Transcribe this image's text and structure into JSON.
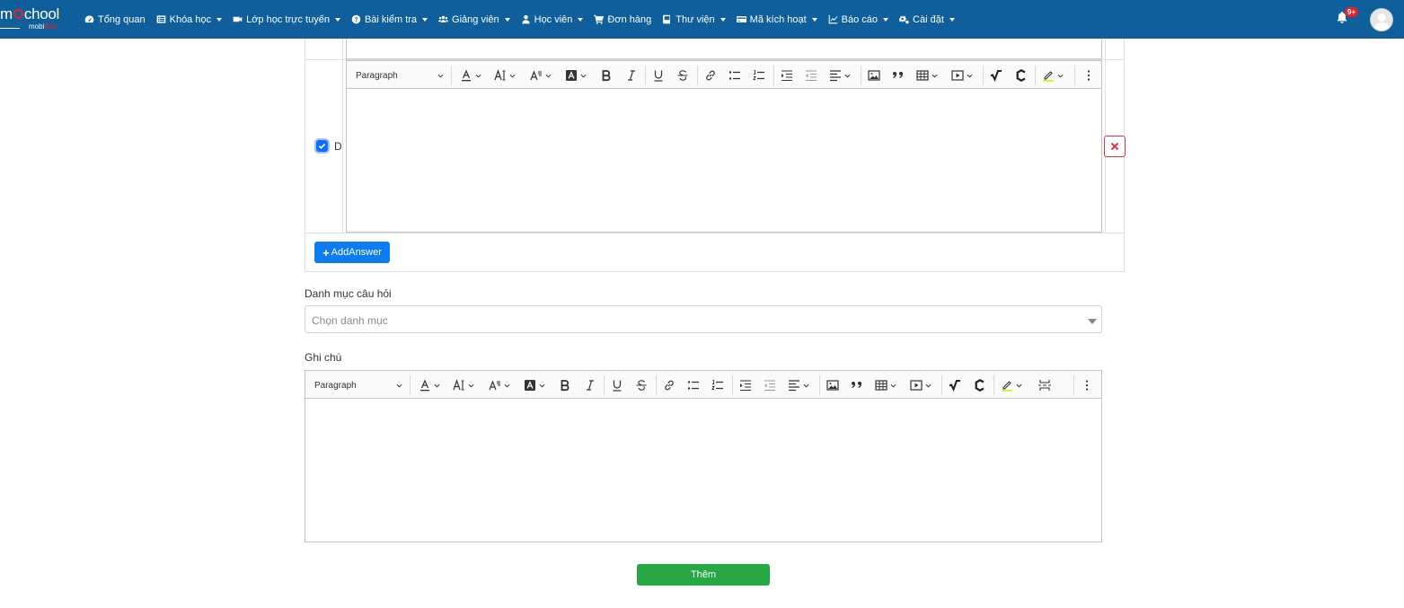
{
  "app": {
    "logo_text": "mSchool",
    "logo_sub": "mobiEdu"
  },
  "nav": {
    "items": [
      {
        "label": "Tổng quan",
        "icon": "dashboard-icon",
        "dropdown": false
      },
      {
        "label": "Khóa học",
        "icon": "list-icon",
        "dropdown": true
      },
      {
        "label": "Lớp học trực tuyến",
        "icon": "video-icon",
        "dropdown": true
      },
      {
        "label": "Bài kiểm tra",
        "icon": "question-circle-icon",
        "dropdown": true
      },
      {
        "label": "Giảng viên",
        "icon": "users-icon",
        "dropdown": true
      },
      {
        "label": "Học viên",
        "icon": "user-icon",
        "dropdown": true
      },
      {
        "label": "Đơn hàng",
        "icon": "cart-icon",
        "dropdown": false
      },
      {
        "label": "Thư viện",
        "icon": "book-icon",
        "dropdown": true
      },
      {
        "label": "Mã kích hoạt",
        "icon": "card-icon",
        "dropdown": true
      },
      {
        "label": "Báo cáo",
        "icon": "chart-icon",
        "dropdown": true
      },
      {
        "label": "Cài đặt",
        "icon": "cogs-icon",
        "dropdown": true
      }
    ],
    "notification_count": "9+"
  },
  "answers": {
    "option_label": "D",
    "option_checked": true,
    "add_button_label": "AddAnswer"
  },
  "editor_toolbar": {
    "paragraph_label": "Paragraph"
  },
  "category": {
    "label": "Danh mục câu hỏi",
    "placeholder": "Chọn danh mục"
  },
  "note": {
    "label": "Ghi chú"
  },
  "submit": {
    "label": "Thêm"
  },
  "colors": {
    "navbar": "#0e5f9c",
    "primary": "#0d7cf2",
    "success": "#28a745",
    "danger": "#dc3545"
  }
}
